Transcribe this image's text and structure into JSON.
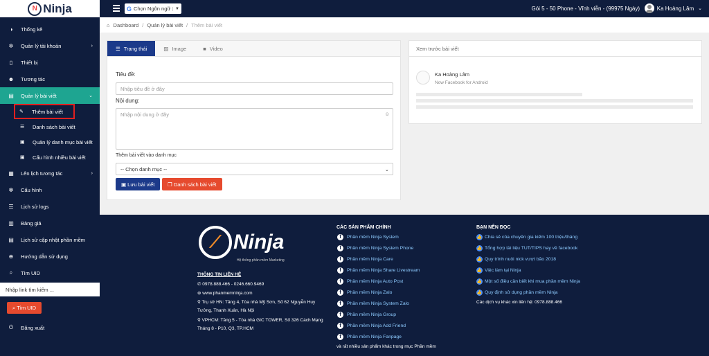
{
  "topbar": {
    "logo_text": "Ninja",
    "logo_mark": "N",
    "language_label": "Chọn Ngôn ngữ",
    "language_icon": "G",
    "package": "Gói 5 - 50 Phone - Vĩnh viễn - (99975 Ngày)",
    "user_name": "Ka Hoàng Lâm"
  },
  "sidebar": {
    "items": [
      {
        "label": "Thống kê",
        "icon": "dashboard-icon"
      },
      {
        "label": "Quản lý tài khoản",
        "icon": "gear-icon"
      },
      {
        "label": "Thiết bị",
        "icon": "phone-icon"
      },
      {
        "label": "Tương tác",
        "icon": "users-icon"
      },
      {
        "label": "Quản lý bài viết",
        "icon": "article-icon"
      },
      {
        "label": "Lên lịch tương tác",
        "icon": "calendar-icon"
      },
      {
        "label": "Cấu hình",
        "icon": "cog-icon"
      },
      {
        "label": "Lịch sử logs",
        "icon": "list-icon"
      },
      {
        "label": "Bảng giá",
        "icon": "price-icon"
      },
      {
        "label": "Lịch sử cập nhật phần mềm",
        "icon": "history-icon"
      },
      {
        "label": "Hướng dẫn sử dụng",
        "icon": "globe-icon"
      },
      {
        "label": "Tìm UID",
        "icon": "search-icon"
      },
      {
        "label": "Đăng xuất",
        "icon": "power-icon"
      }
    ],
    "subitems": [
      {
        "label": "Thêm bài viết"
      },
      {
        "label": "Danh sách bài viết"
      },
      {
        "label": "Quản lý danh mục bài viết"
      },
      {
        "label": "Cấu hình nhiều bài viết"
      }
    ],
    "uid_placeholder": "Nhập link tìm kiếm ...",
    "uid_button": "Tìm UID"
  },
  "breadcrumb": [
    "Dashboard",
    "Quản lý bài viết",
    "Thêm bài viết"
  ],
  "editor": {
    "tabs": [
      "Trạng thái",
      "Image",
      "Video"
    ],
    "title_label": "Tiêu đề:",
    "title_placeholder": "Nhập tiêu đề ở đây",
    "content_label": "Nội dung:",
    "content_placeholder": "Nhập nội dung ở đây",
    "category_label": "Thêm bài viết vào danh mục",
    "category_value": "-- Chọn danh mục --",
    "save_button": "Lưu bài viết",
    "list_button": "Danh sách bài viết"
  },
  "preview": {
    "header": "Xem trước bài viết",
    "name": "Ka Hoàng Lâm",
    "subtitle": "Now Facebook for Android"
  },
  "footer": {
    "logo_text": "Ninja",
    "tagline": "Hệ thống phần mềm Marketing",
    "contact_title": "THÔNG TIN LIÊN HỆ",
    "phone": "0978.888.466 - 0246.660.9469",
    "website": "www.phanmemninja.com",
    "hn_address_1": "Trụ sở HN: Tầng 4, Tòa nhà Mỹ Sơn, Số 62 Nguyễn Huy",
    "hn_address_2": "Tưởng, Thanh Xuân, Hà Nội",
    "hcm_address_1": "VPHCM: Tầng 5 - Tòa nhà GIC TOWER, Số 326 Cách Mạng",
    "hcm_address_2": "Tháng 8 - P10, Q3, TP.HCM",
    "products_title": "CÁC SẢN PHẨM CHÍNH",
    "products": [
      "Phần mềm Ninja System",
      "Phần mềm Ninja System Phone",
      "Phần mềm Ninja Care",
      "Phần mềm Ninja Share Livestream",
      "Phần mềm Ninja Auto Post",
      "Phần mềm Ninja Zalo",
      "Phần mềm Ninja System Zalo",
      "Phần mềm Ninja Group",
      "Phần mềm Ninja Add Friend",
      "Phần mềm Ninja Fanpage"
    ],
    "products_more": "và rất nhiều sản phẩm khác trong mục Phần mềm",
    "reading_title": "BẠN NÊN ĐỌC",
    "reading": [
      "Chia sẻ của chuyên gia kiếm 100 triệu/tháng",
      "Tổng hợp tài liệu TUT/TIPS hay về facebook",
      "Quy trình nuôi nick vượt bão 2018",
      "Việc làm tại Ninja",
      "Một số điều cần biết khi mua phần mềm Ninja",
      "Quy định sử dụng phần mềm Ninja"
    ],
    "reading_more": "Các dịch vụ khác xin liên hệ: 0978.888.466"
  }
}
